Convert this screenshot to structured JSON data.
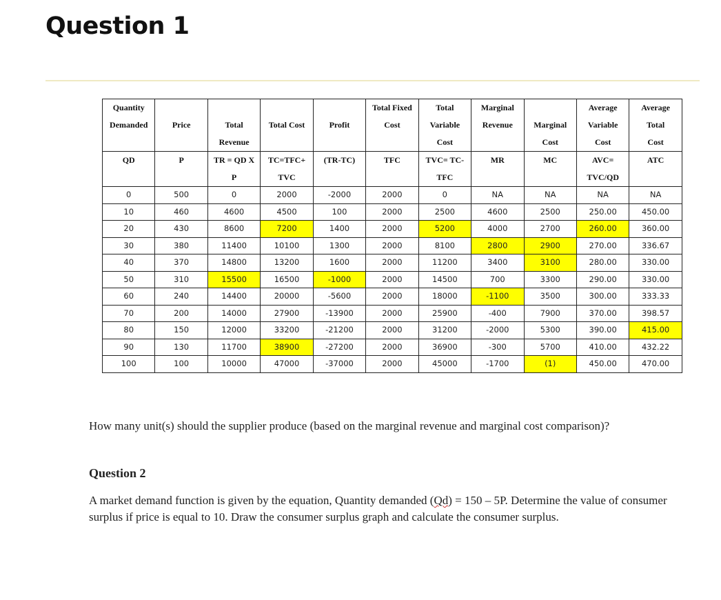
{
  "page": {
    "title": "Question 1"
  },
  "table": {
    "headers_row1": [
      [
        "Quantity",
        "Demanded"
      ],
      [
        "",
        "Price"
      ],
      [
        "",
        "Total",
        "Revenue"
      ],
      [
        "",
        "Total Cost"
      ],
      [
        "",
        "Profit"
      ],
      [
        "Total Fixed",
        "Cost"
      ],
      [
        "Total",
        "Variable",
        "Cost"
      ],
      [
        "Marginal",
        "Revenue"
      ],
      [
        "",
        "Marginal",
        "Cost"
      ],
      [
        "Average",
        "Variable",
        "Cost"
      ],
      [
        "Average",
        "Total",
        "Cost"
      ]
    ],
    "headers_row2": [
      [
        "QD"
      ],
      [
        "P"
      ],
      [
        "TR = QD X",
        "P"
      ],
      [
        "TC=TFC+",
        "TVC"
      ],
      [
        "(TR-TC)"
      ],
      [
        "TFC"
      ],
      [
        "TVC= TC-",
        "TFC"
      ],
      [
        "MR"
      ],
      [
        "MC"
      ],
      [
        "AVC=",
        "TVC/QD"
      ],
      [
        "ATC"
      ]
    ],
    "rows": [
      [
        "0",
        "500",
        "0",
        "2000",
        "-2000",
        "2000",
        "0",
        "NA",
        "NA",
        "NA",
        "NA"
      ],
      [
        "10",
        "460",
        "4600",
        "4500",
        "100",
        "2000",
        "2500",
        "4600",
        "2500",
        "250.00",
        "450.00"
      ],
      [
        "20",
        "430",
        "8600",
        "7200",
        "1400",
        "2000",
        "5200",
        "4000",
        "2700",
        "260.00",
        "360.00"
      ],
      [
        "30",
        "380",
        "11400",
        "10100",
        "1300",
        "2000",
        "8100",
        "2800",
        "2900",
        "270.00",
        "336.67"
      ],
      [
        "40",
        "370",
        "14800",
        "13200",
        "1600",
        "2000",
        "11200",
        "3400",
        "3100",
        "280.00",
        "330.00"
      ],
      [
        "50",
        "310",
        "15500",
        "16500",
        "-1000",
        "2000",
        "14500",
        "700",
        "3300",
        "290.00",
        "330.00"
      ],
      [
        "60",
        "240",
        "14400",
        "20000",
        "-5600",
        "2000",
        "18000",
        "-1100",
        "3500",
        "300.00",
        "333.33"
      ],
      [
        "70",
        "200",
        "14000",
        "27900",
        "-13900",
        "2000",
        "25900",
        "-400",
        "7900",
        "370.00",
        "398.57"
      ],
      [
        "80",
        "150",
        "12000",
        "33200",
        "-21200",
        "2000",
        "31200",
        "-2000",
        "5300",
        "390.00",
        "415.00"
      ],
      [
        "90",
        "130",
        "11700",
        "38900",
        "-27200",
        "2000",
        "36900",
        "-300",
        "5700",
        "410.00",
        "432.22"
      ],
      [
        "100",
        "100",
        "10000",
        "47000",
        "-37000",
        "2000",
        "45000",
        "-1700",
        "(1)",
        "450.00",
        "470.00"
      ]
    ],
    "highlighted_cells": [
      [
        2,
        3
      ],
      [
        2,
        6
      ],
      [
        2,
        9
      ],
      [
        3,
        7
      ],
      [
        3,
        8
      ],
      [
        4,
        8
      ],
      [
        5,
        2
      ],
      [
        5,
        4
      ],
      [
        6,
        7
      ],
      [
        8,
        10
      ],
      [
        9,
        3
      ],
      [
        10,
        8
      ]
    ],
    "highlight_color": "#ffff00"
  },
  "question1_text": "How many unit(s) should the supplier produce (based on the marginal revenue and marginal cost comparison)?",
  "question2": {
    "heading": "Question 2",
    "text_before": "A market demand function is given by the equation, Quantity demanded (",
    "text_qd": "Qd",
    "text_after": ") = 150 – 5P. Determine the value of consumer surplus if price is equal to 10. Draw the consumer surplus graph and calculate the consumer surplus."
  }
}
